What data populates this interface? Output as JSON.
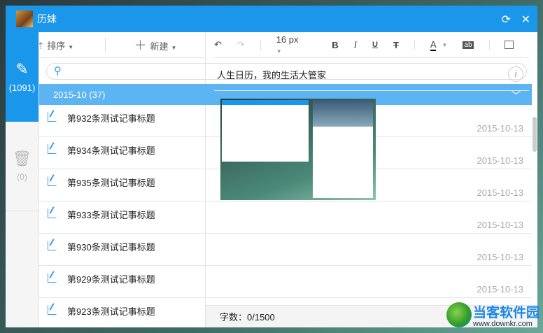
{
  "window": {
    "title": "历妹"
  },
  "actions": {
    "sort": "排序",
    "new": "新建"
  },
  "rail": {
    "notes_count": "(1091)",
    "trash_count": "(0)"
  },
  "search": {
    "placeholder": ""
  },
  "group": {
    "label": "2015-10 (37)"
  },
  "notes": [
    {
      "title": "第932条测试记事标题",
      "date": "2015-10-13"
    },
    {
      "title": "第934条测试记事标题",
      "date": "2015-10-13"
    },
    {
      "title": "第935条测试记事标题",
      "date": "2015-10-13"
    },
    {
      "title": "第933条测试记事标题",
      "date": "2015-10-13"
    },
    {
      "title": "第930条测试记事标题",
      "date": "2015-10-13"
    },
    {
      "title": "第929条测试记事标题",
      "date": "2015-10-13"
    },
    {
      "title": "第923条测试记事标题",
      "date": "2015-10-13"
    }
  ],
  "toolbar": {
    "font_size": "16 px"
  },
  "editor": {
    "title": "人生日历，我的生活大管家",
    "word_count": "字数：0/1500"
  },
  "watermark": {
    "name": "当客软件园",
    "url": "www.downkr.com"
  }
}
